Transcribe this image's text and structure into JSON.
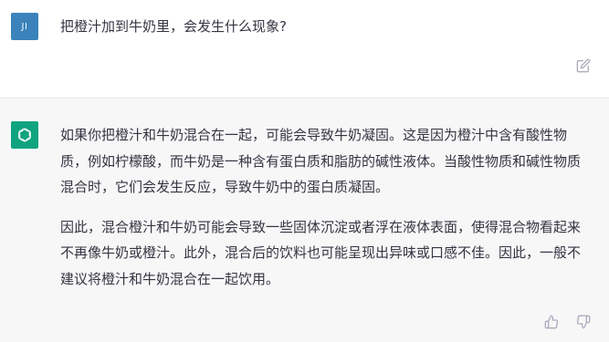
{
  "user_message": {
    "avatar_initials": "JI",
    "text": "把橙汁加到牛奶里，会发生什么现象?"
  },
  "assistant_message": {
    "paragraphs": [
      "如果你把橙汁和牛奶混合在一起，可能会导致牛奶凝固。这是因为橙汁中含有酸性物质，例如柠檬酸，而牛奶是一种含有蛋白质和脂肪的碱性液体。当酸性物质和碱性物质混合时，它们会发生反应，导致牛奶中的蛋白质凝固。",
      "因此，混合橙汁和牛奶可能会导致一些固体沉淀或者浮在液体表面，使得混合物看起来不再像牛奶或橙汁。此外，混合后的饮料也可能呈现出异味或口感不佳。因此，一般不建议将橙汁和牛奶混合在一起饮用。"
    ]
  },
  "icons": {
    "edit": "edit-icon",
    "thumbs_up": "thumbs-up-icon",
    "thumbs_down": "thumbs-down-icon",
    "assistant_logo": "openai-logo-icon"
  },
  "colors": {
    "user_avatar": "#3b83ba",
    "assistant_avatar": "#10a37f",
    "assistant_bg": "#f7f7f8",
    "text": "#343541",
    "icon": "#acacbe"
  }
}
